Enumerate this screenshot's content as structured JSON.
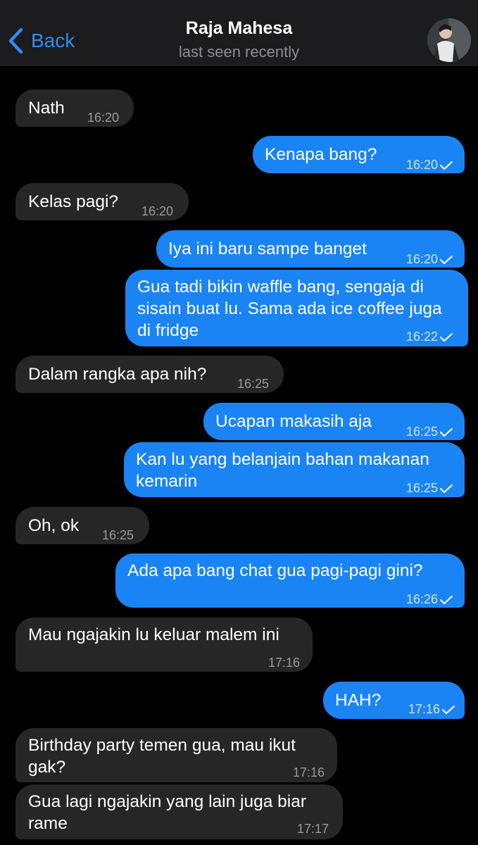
{
  "header": {
    "back_label": "Back",
    "contact_name": "Raja Mahesa",
    "status": "last seen recently"
  },
  "colors": {
    "outgoing": "#1a84f5",
    "incoming": "#262626",
    "accent": "#2f8cf4"
  },
  "messages": [
    {
      "dir": "in",
      "text": "Nath",
      "time": "16:20"
    },
    {
      "dir": "out",
      "text": "Kenapa bang?",
      "time": "16:20",
      "read": true
    },
    {
      "dir": "in",
      "text": "Kelas pagi?",
      "time": "16:20"
    },
    {
      "dir": "out",
      "text": "Iya ini baru sampe banget",
      "time": "16:20",
      "read": true
    },
    {
      "dir": "out",
      "text": "Gua tadi bikin waffle bang, sengaja di sisain buat lu. Sama ada ice coffee juga di fridge",
      "time": "16:22",
      "read": true
    },
    {
      "dir": "in",
      "text": "Dalam rangka apa nih?",
      "time": "16:25"
    },
    {
      "dir": "out",
      "text": "Ucapan makasih aja",
      "time": "16:25",
      "read": true
    },
    {
      "dir": "out",
      "text": "Kan lu yang belanjain bahan makanan kemarin",
      "time": "16:25",
      "read": true
    },
    {
      "dir": "in",
      "text": "Oh, ok",
      "time": "16:25"
    },
    {
      "dir": "out",
      "text": "Ada apa bang chat gua pagi-pagi gini?",
      "time": "16:26",
      "read": true
    },
    {
      "dir": "in",
      "text": "Mau ngajakin lu keluar malem ini",
      "time": "17:16"
    },
    {
      "dir": "out",
      "text": "HAH?",
      "time": "17:16",
      "read": true
    },
    {
      "dir": "in",
      "text": "Birthday party temen gua, mau ikut gak?",
      "time": "17:16"
    },
    {
      "dir": "in",
      "text": "Gua lagi ngajakin yang lain juga biar rame",
      "time": "17:17"
    }
  ]
}
